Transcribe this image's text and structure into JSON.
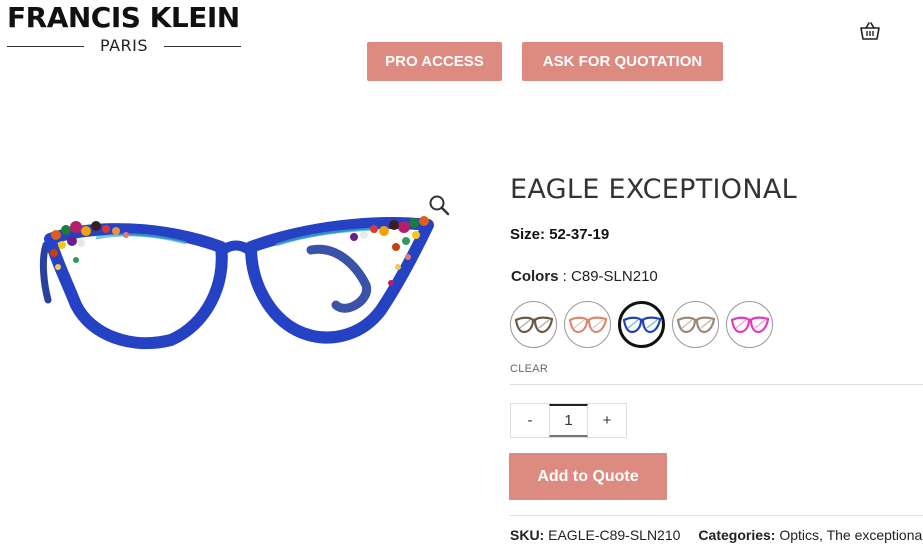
{
  "header": {
    "logo_main": "FRANCIS KLEIN",
    "logo_sub": "PARIS",
    "pro_access_label": "PRO ACCESS",
    "ask_quotation_label": "ASK FOR QUOTATION",
    "cart_icon": "basket-icon",
    "accent_color": "#dd8a80"
  },
  "product": {
    "title": "EAGLE EXCEPTIONAL",
    "size_label": "Size:",
    "size_value": "52-37-19",
    "colors_label": "Colors",
    "colors_sep": " : ",
    "color_selected": "C89-SLN210",
    "swatches": [
      {
        "name": "tortoise-brown",
        "frame_color": "#6b5a48",
        "accent": "#9aa08a"
      },
      {
        "name": "coral-pink",
        "frame_color": "#d98b74",
        "accent": "#c9c0b8"
      },
      {
        "name": "blue-crystal",
        "frame_color": "#2541b8",
        "accent": "#3cb0c8",
        "selected": true
      },
      {
        "name": "grey-taupe",
        "frame_color": "#9a8878",
        "accent": "#b9a892"
      },
      {
        "name": "magenta",
        "frame_color": "#e23bbd",
        "accent": "#f07fd8"
      }
    ],
    "clear_label": "CLEAR",
    "quantity": "1",
    "qty_minus": "-",
    "qty_plus": "+",
    "add_to_quote_label": "Add to Quote",
    "zoom_icon": "zoom-icon",
    "sku_label": "SKU:",
    "sku_value": "EAGLE-C89-SLN210",
    "categories_label": "Categories:",
    "category_1": "Optics",
    "category_sep": ", ",
    "category_2": "The exceptional"
  }
}
